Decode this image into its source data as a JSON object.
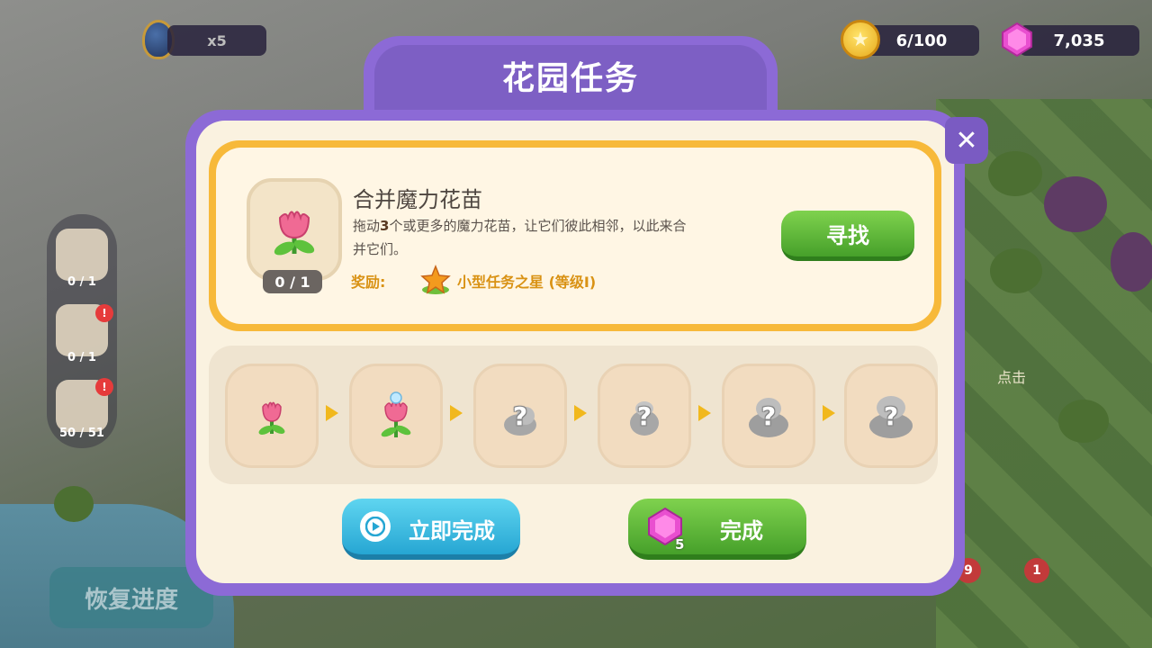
{
  "hud": {
    "egg_count": "x5",
    "coins": "6/100",
    "gems": "7,035"
  },
  "side_panel": {
    "items": [
      {
        "label": "0 / 1",
        "badge": ""
      },
      {
        "label": "0 / 1",
        "badge": "!"
      },
      {
        "label": "50 / 51",
        "badge": "!"
      }
    ],
    "restore_label": "恢复进度"
  },
  "right_side": {
    "badge_a": "9",
    "badge_b": "1",
    "click_hint": "点击"
  },
  "dialog": {
    "title": "花园任务",
    "close_label": "✕",
    "task": {
      "name": "合并魔力花苗",
      "desc_prefix": "拖动",
      "desc_number": "3",
      "desc_suffix": "个或更多的魔力花苗，让它们彼此相邻，以此来合并它们。",
      "progress": "0 / 1",
      "reward_label": "奖励:",
      "reward_name": "小型任务之星 (等级I)",
      "find_button": "寻找"
    },
    "chain": {
      "unknown_mark": "?"
    },
    "instant_button": "立即完成",
    "complete_button": "完成",
    "complete_cost": "5"
  },
  "colors": {
    "dialog_purple": "#8c6ad6",
    "card_gold": "#f7b93a",
    "green_button": "#46a02a",
    "blue_button": "#26a6d3",
    "reward_text": "#d99214"
  }
}
